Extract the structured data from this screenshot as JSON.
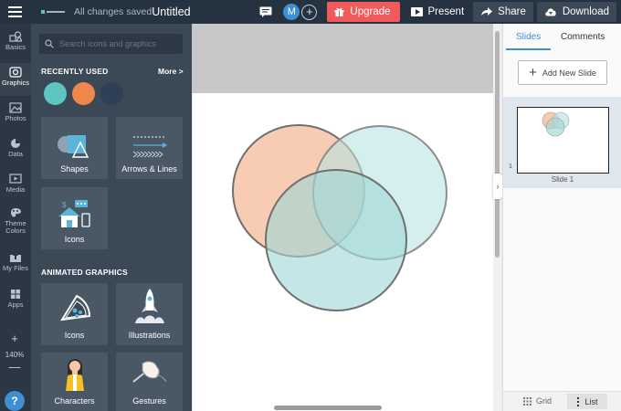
{
  "topbar": {
    "saved_status": "All changes saved",
    "doc_title": "Untitled",
    "avatar_initial": "M",
    "add_collaborator": "+",
    "upgrade_label": "Upgrade",
    "present_label": "Present",
    "share_label": "Share",
    "download_label": "Download",
    "accent_upgrade": "#f05a5a"
  },
  "rail": {
    "items": [
      {
        "label": "Basics",
        "icon": "shapes-icon"
      },
      {
        "label": "Graphics",
        "icon": "graphics-icon"
      },
      {
        "label": "Photos",
        "icon": "image-icon"
      },
      {
        "label": "Data",
        "icon": "pie-chart-icon"
      },
      {
        "label": "Media",
        "icon": "media-icon"
      },
      {
        "label": "Theme Colors",
        "icon": "palette-icon"
      },
      {
        "label": "My Files",
        "icon": "upload-icon"
      },
      {
        "label": "Apps",
        "icon": "apps-grid-icon"
      }
    ],
    "zoom_in": "+",
    "zoom_level": "140%",
    "zoom_out": "—",
    "help": "?"
  },
  "panel": {
    "search_placeholder": "Search icons and graphics",
    "recently_used_title": "RECENTLY USED",
    "more_label": "More >",
    "swatches": [
      "#5ec5c0",
      "#f0874a",
      "#2f3f56"
    ],
    "categories": [
      {
        "label": "Shapes"
      },
      {
        "label": "Arrows & Lines"
      },
      {
        "label": "Icons"
      }
    ],
    "animated_title": "ANIMATED GRAPHICS",
    "animated": [
      {
        "label": "Icons"
      },
      {
        "label": "Illustrations"
      },
      {
        "label": "Characters"
      },
      {
        "label": "Gestures"
      }
    ]
  },
  "canvas": {
    "circle_colors": [
      "#f4b896",
      "#b9e2e2",
      "#9fd6d6"
    ]
  },
  "right_panel": {
    "tab_slides": "Slides",
    "tab_comments": "Comments",
    "add_slide_label": "Add New Slide",
    "slide_number": "1",
    "slide_label": "Slide 1",
    "view_grid": "Grid",
    "view_list": "List"
  }
}
